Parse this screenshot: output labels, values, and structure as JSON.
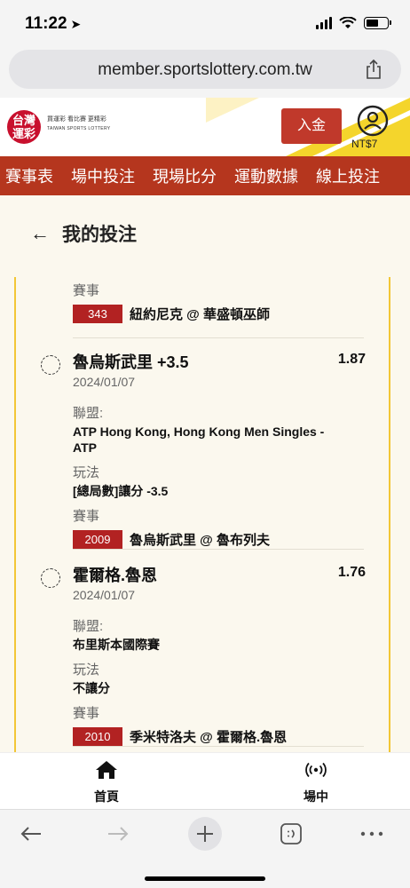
{
  "status_bar": {
    "time": "11:22",
    "location_arrow": "location-arrow-icon"
  },
  "browser": {
    "url": "member.sportslottery.com.tw"
  },
  "header": {
    "logo_badge": "台灣\n運彩",
    "logo_tagline": "買運彩 看比賽 更精彩",
    "logo_en": "TAIWAN SPORTS LOTTERY",
    "deposit_label": "入金",
    "balance": "NT$7"
  },
  "nav": {
    "items": [
      "賽事表",
      "場中投注",
      "現場比分",
      "運動數據",
      "線上投注"
    ]
  },
  "page": {
    "title": "我的投注"
  },
  "first_block": {
    "game_label": "賽事",
    "game_id": "343",
    "game_name": "紐約尼克 @ 華盛頓巫師"
  },
  "bets": [
    {
      "selection": "魯烏斯武里 +3.5",
      "odds": "1.87",
      "date": "2024/01/07",
      "league_label": "聯盟:",
      "league": "ATP Hong Kong, Hong Kong Men Singles - ATP",
      "play_label": "玩法",
      "play": "[總局數]讓分 -3.5",
      "game_label": "賽事",
      "game_id": "2009",
      "game_name": "魯烏斯武里 @ 魯布列夫"
    },
    {
      "selection": "霍爾格.魯恩",
      "odds": "1.76",
      "date": "2024/01/07",
      "league_label": "聯盟:",
      "league": "布里斯本國際賽",
      "play_label": "玩法",
      "play": "不讓分",
      "game_label": "賽事",
      "game_id": "2010",
      "game_name": "季米特洛夫 @ 霍爾格.魯恩"
    }
  ],
  "app_nav": {
    "home_label": "首頁",
    "live_label": "場中"
  },
  "colors": {
    "brand_red": "#b5361e",
    "accent_yellow": "#f2c636",
    "game_id_red": "#b22222",
    "content_bg": "#fbf8ee"
  }
}
